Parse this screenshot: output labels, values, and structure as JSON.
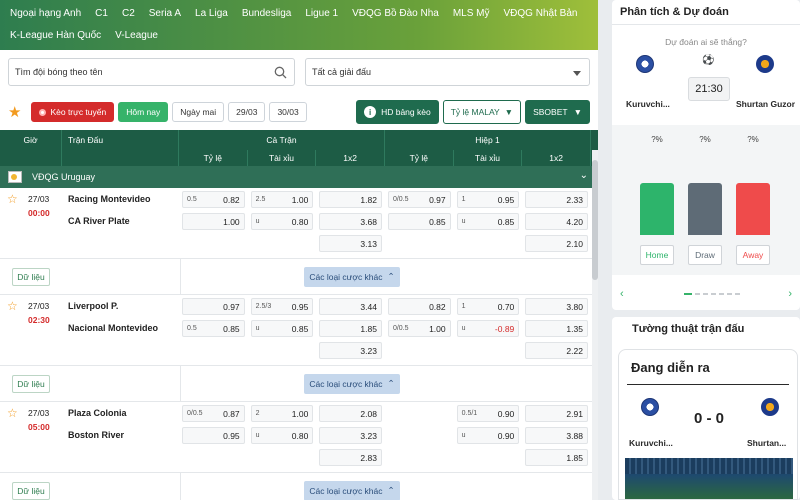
{
  "nav": {
    "row1": [
      "Ngoại hạng Anh",
      "C1",
      "C2",
      "Seria A",
      "La Liga",
      "Bundesliga",
      "Ligue 1",
      "VĐQG Bồ Đào Nha",
      "MLS Mỹ",
      "VĐQG Nhật Bản"
    ],
    "row2": [
      "K-League Hàn Quốc",
      "V-League"
    ]
  },
  "filters": {
    "search_placeholder": "Tìm đội bóng theo tên",
    "league_select": "Tất cả giải đấu"
  },
  "toolbar": {
    "live": "Kèo trực tuyến",
    "today": "Hôm nay",
    "tomorrow": "Ngày mai",
    "d1": "29/03",
    "d2": "30/03",
    "hd": "HD bảng kèo",
    "ratio": "Tỷ lệ MALAY",
    "bookmaker": "SBOBET"
  },
  "table_header": {
    "time": "Giờ",
    "match": "Trận Đấu",
    "full": "Cả Trận",
    "half": "Hiệp 1",
    "sub": [
      "Tỷ lệ",
      "Tài xỉu",
      "1x2",
      "Tỷ lệ",
      "Tài xỉu",
      "1x2"
    ]
  },
  "league": "VĐQG Uruguay",
  "matches": [
    {
      "date": "27/03",
      "time": "00:00",
      "home": "Racing Montevideo",
      "away": "CA River Plate",
      "cols": [
        [
          [
            "0.5",
            "0.82"
          ],
          [
            "",
            "1.00"
          ],
          null
        ],
        [
          [
            "2.5",
            "1.00"
          ],
          [
            "u",
            "0.80"
          ],
          null
        ],
        [
          [
            "",
            "1.82"
          ],
          [
            "",
            "3.68"
          ],
          [
            "",
            "3.13"
          ]
        ],
        [
          [
            "0/0.5",
            "0.97"
          ],
          [
            "",
            "0.85"
          ],
          null
        ],
        [
          [
            "1",
            "0.95"
          ],
          [
            "u",
            "0.85"
          ],
          null
        ],
        [
          [
            "",
            "2.33"
          ],
          [
            "",
            "4.20"
          ],
          [
            "",
            "2.10"
          ]
        ]
      ]
    },
    {
      "date": "27/03",
      "time": "02:30",
      "home": "Liverpool P.",
      "away": "Nacional Montevideo",
      "cols": [
        [
          [
            "",
            "0.97"
          ],
          [
            "0.5",
            "0.85"
          ],
          null
        ],
        [
          [
            "2.5/3",
            "0.95"
          ],
          [
            "u",
            "0.85"
          ],
          null
        ],
        [
          [
            "",
            "3.44"
          ],
          [
            "",
            "1.85"
          ],
          [
            "",
            "3.23"
          ]
        ],
        [
          [
            "",
            "0.82"
          ],
          [
            "0/0.5",
            "1.00"
          ],
          null
        ],
        [
          [
            "1",
            "0.70"
          ],
          [
            "u",
            "-0.89"
          ],
          null
        ],
        [
          [
            "",
            "3.80"
          ],
          [
            "",
            "1.35"
          ],
          [
            "",
            "2.22"
          ]
        ]
      ]
    },
    {
      "date": "27/03",
      "time": "05:00",
      "home": "Plaza Colonia",
      "away": "Boston River",
      "cols": [
        [
          [
            "0/0.5",
            "0.87"
          ],
          [
            "",
            "0.95"
          ],
          null
        ],
        [
          [
            "2",
            "1.00"
          ],
          [
            "u",
            "0.80"
          ],
          null
        ],
        [
          [
            "",
            "2.08"
          ],
          [
            "",
            "3.23"
          ],
          [
            "",
            "2.83"
          ]
        ],
        [
          null,
          null,
          null
        ],
        [
          [
            "0.5/1",
            "0.90"
          ],
          [
            "u",
            "0.90"
          ],
          null
        ],
        [
          [
            "",
            "2.91"
          ],
          [
            "",
            "3.88"
          ],
          [
            "",
            "1.85"
          ]
        ]
      ]
    }
  ],
  "data_label": "Dữ liệu",
  "more_label": "Các loại cược khác",
  "prediction": {
    "title": "Phân tích & Dự đoán",
    "question": "Dự đoán ai sẽ thắng?",
    "home_team": "Kuruvchi...",
    "away_team": "Shurtan Guzor",
    "time": "21:30",
    "bars": [
      {
        "label": "Home",
        "pct": "?%",
        "color": "#2db46b"
      },
      {
        "label": "Draw",
        "pct": "?%",
        "color": "#5e6b76"
      },
      {
        "label": "Away",
        "pct": "?%",
        "color": "#ef4b4b"
      }
    ]
  },
  "commentary": {
    "title": "Tường thuật trận đấu",
    "status": "Đang diễn ra",
    "score": "0 - 0",
    "home_team": "Kuruvchi...",
    "away_team": "Shurtan..."
  }
}
